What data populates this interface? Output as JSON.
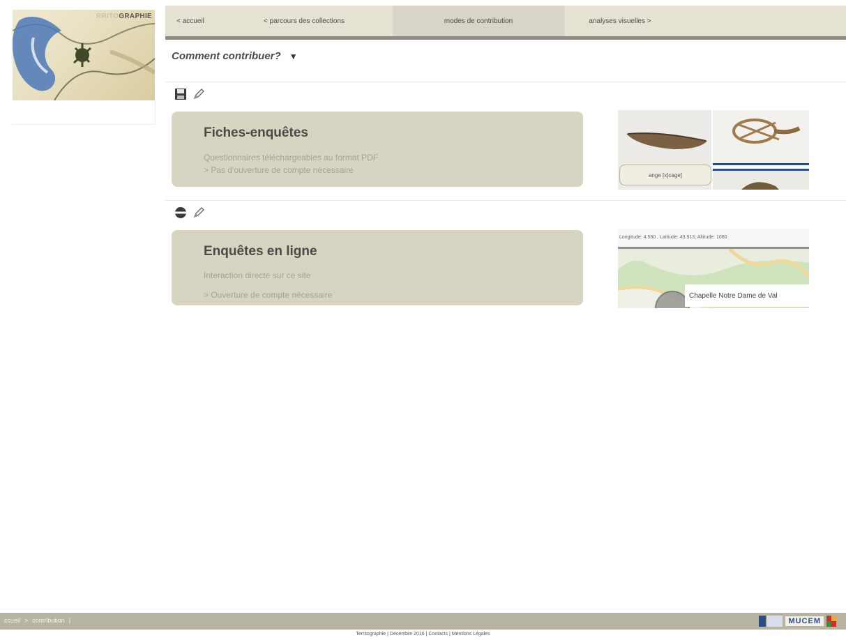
{
  "logo": {
    "title_part_a": "RRITO",
    "title_part_b": "GRAPHIE"
  },
  "nav": {
    "items": [
      {
        "label": "< accueil"
      },
      {
        "label": "< parcours des collections"
      },
      {
        "label": "modes de contribution",
        "active": true
      },
      {
        "label": "analyses visuelles >"
      }
    ]
  },
  "section": {
    "title": "Comment contribuer?",
    "toggle_glyph": "▼"
  },
  "cards": [
    {
      "title": "Fiches-enquêtes",
      "line1": "Questionnaires téléchargeables au format PDF",
      "line2": "> Pas d'ouverture de compte nécessaire",
      "icons": [
        "save-icon",
        "pencil-icon"
      ]
    },
    {
      "title": "Enquêtes en ligne",
      "line1": "Interaction directe sur ce site",
      "line2": "> Ouverture de compte nécessaire",
      "icons": [
        "globe-icon",
        "pencil-icon"
      ]
    }
  ],
  "thumb1": {
    "label": "ange [x]cage]"
  },
  "thumb2": {
    "coords": "Longitude: 4.590 , Latitude: 43.913, Altitude: 1060",
    "callout": "Chapelle Notre Dame de Val"
  },
  "footer": {
    "breadcrumb": [
      "ccueil",
      ">",
      "contribution",
      "|"
    ],
    "partner": "MUCEM",
    "text": "Territographie | Décembre 2016 | Contacts | Mentions Légales"
  },
  "colors": {
    "card_bg": "#d8d4c2",
    "nav_bg": "#e5e1d3",
    "footer_bg": "#b8b4a2",
    "accent_blue": "#2d4d8a"
  }
}
